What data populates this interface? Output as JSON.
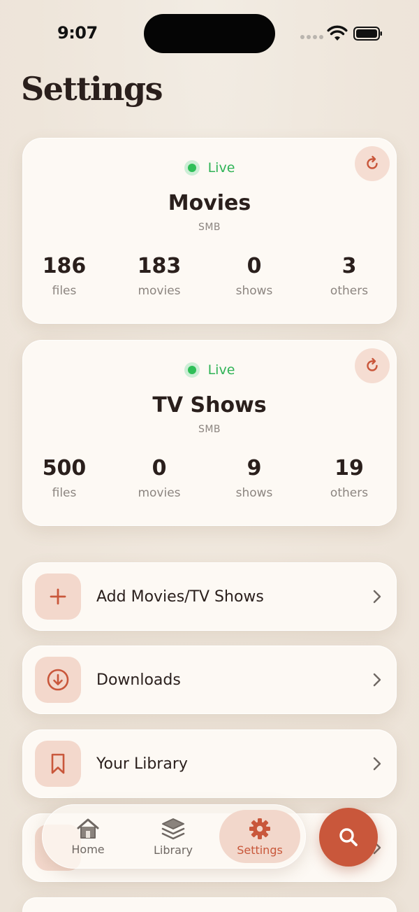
{
  "status_bar": {
    "time": "9:07"
  },
  "page": {
    "title": "Settings"
  },
  "libraries": [
    {
      "status": "Live",
      "name": "Movies",
      "protocol": "SMB",
      "stats": [
        {
          "value": "186",
          "label": "files"
        },
        {
          "value": "183",
          "label": "movies"
        },
        {
          "value": "0",
          "label": "shows"
        },
        {
          "value": "3",
          "label": "others"
        }
      ]
    },
    {
      "status": "Live",
      "name": "TV Shows",
      "protocol": "SMB",
      "stats": [
        {
          "value": "500",
          "label": "files"
        },
        {
          "value": "0",
          "label": "movies"
        },
        {
          "value": "9",
          "label": "shows"
        },
        {
          "value": "19",
          "label": "others"
        }
      ]
    }
  ],
  "menu": [
    {
      "label": "Add Movies/TV Shows",
      "icon": "plus-icon"
    },
    {
      "label": "Downloads",
      "icon": "download-icon"
    },
    {
      "label": "Your Library",
      "icon": "bookmark-icon"
    }
  ],
  "tab_bar": {
    "tabs": [
      {
        "label": "Home",
        "icon": "home-icon"
      },
      {
        "label": "Library",
        "icon": "layers-icon"
      },
      {
        "label": "Settings",
        "icon": "gear-icon",
        "active": true
      }
    ]
  },
  "colors": {
    "accent": "#c9573b",
    "live": "#2fb356",
    "background": "#eee5da",
    "card": "#fdf9f4"
  }
}
